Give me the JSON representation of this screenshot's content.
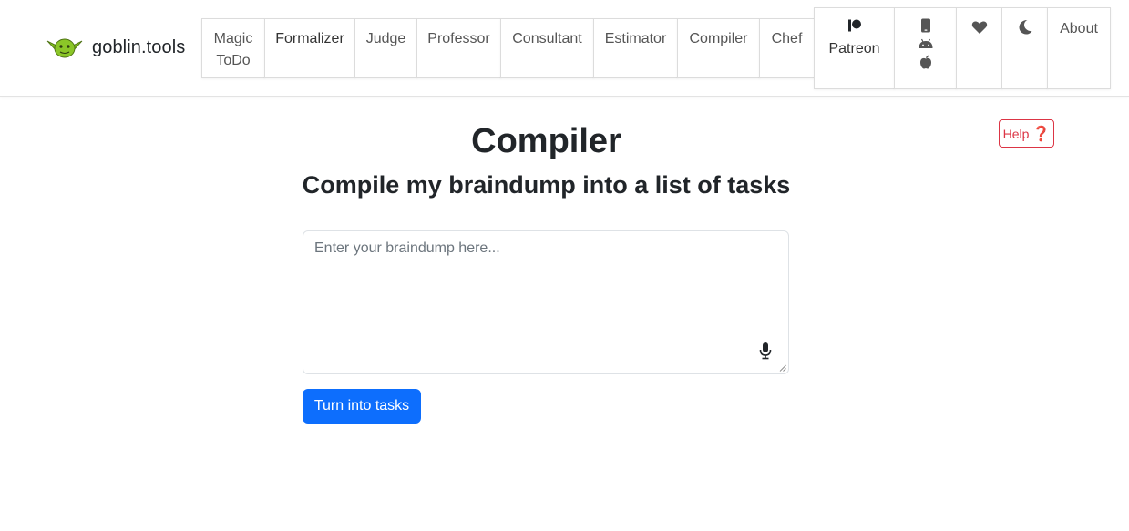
{
  "brand": {
    "name": "goblin.tools"
  },
  "nav": {
    "magic_todo_line1": "Magic",
    "magic_todo_line2": "ToDo",
    "formalizer": "Formalizer",
    "judge": "Judge",
    "professor": "Professor",
    "consultant": "Consultant",
    "estimator": "Estimator",
    "compiler": "Compiler",
    "chef": "Chef",
    "patreon": "Patreon",
    "about": "About"
  },
  "icons": {
    "brand": "goblin-head-icon",
    "patreon": "patreon-icon",
    "mobile": "mobile-phone-icon",
    "android": "android-icon",
    "apple": "apple-icon",
    "support": "heart-icon",
    "theme": "moon-icon",
    "help": "question-icon",
    "dictate": "microphone-icon"
  },
  "main": {
    "title": "Compiler",
    "subtitle": "Compile my braindump into a list of tasks",
    "help_label": "Help",
    "help_mark": "❓",
    "braindump_placeholder": "Enter your braindump here...",
    "braindump_value": "",
    "submit_label": "Turn into tasks"
  },
  "colors": {
    "primary": "#0d6efd",
    "danger": "#dc3545",
    "goblin_green": "#8bc628",
    "text": "#212529",
    "nav_text": "#555555"
  }
}
